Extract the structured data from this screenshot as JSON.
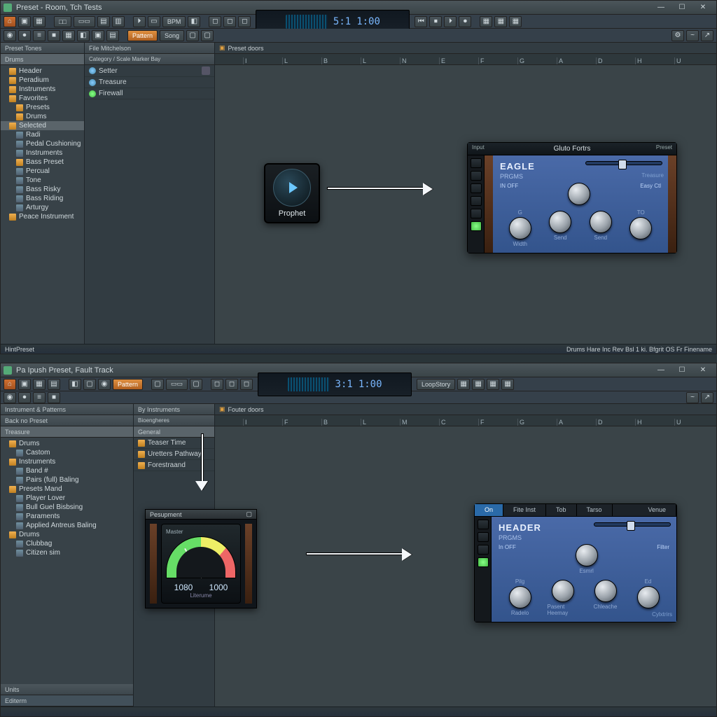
{
  "top": {
    "title": "Preset - Room, Tch Tests",
    "toolbar": {
      "row1_labels": [
        "⌂",
        "▣",
        "□",
        "▦",
        "≡",
        "▭",
        "✚"
      ],
      "row2_labels": [
        "◉",
        "⏺",
        "≡",
        "■",
        "▦",
        "◧",
        "▣",
        "▤"
      ],
      "pattern_btn": "Pattern",
      "song_btn": "Song",
      "bpm_btn": "BPM"
    },
    "transport": {
      "bar": "5:1",
      "time": "1:00"
    },
    "left_header": "Preset Tones",
    "left_tab": "Drums",
    "tree": [
      {
        "t": "Header",
        "lv": 1,
        "i": "folder"
      },
      {
        "t": "Peradium",
        "lv": 1,
        "i": "folder"
      },
      {
        "t": "Instruments",
        "lv": 1,
        "i": "folder"
      },
      {
        "t": "Favorites",
        "lv": 1,
        "i": "folder"
      },
      {
        "t": "Presets",
        "lv": 2,
        "i": "folder"
      },
      {
        "t": "Drums",
        "lv": 2,
        "i": "folder"
      },
      {
        "t": "Selected",
        "lv": 1,
        "i": "folder",
        "sel": true
      },
      {
        "t": "Radi",
        "lv": 2,
        "i": "file"
      },
      {
        "t": "Pedal Cushioning",
        "lv": 2,
        "i": "file"
      },
      {
        "t": "Instruments",
        "lv": 2,
        "i": "file"
      },
      {
        "t": "Bass Preset",
        "lv": 2,
        "i": "folder"
      },
      {
        "t": "Percual",
        "lv": 2,
        "i": "file"
      },
      {
        "t": "Tone",
        "lv": 2,
        "i": "file"
      },
      {
        "t": "Bass Risky",
        "lv": 2,
        "i": "file"
      },
      {
        "t": "Bass Riding",
        "lv": 2,
        "i": "file"
      },
      {
        "t": "Arturgy",
        "lv": 2,
        "i": "file"
      },
      {
        "t": "Peace Instrument",
        "lv": 1,
        "i": "folder"
      }
    ],
    "mid_header": "File Mitchelson",
    "mid_sub": "Category / Scale Marker Bay",
    "mid_items": [
      {
        "t": "Setter",
        "i": "blue",
        "badge": true
      },
      {
        "t": "Treasure",
        "i": "blue"
      },
      {
        "t": "Firewall",
        "i": "green"
      }
    ],
    "canvas_header": "Preset doors",
    "ruler": [
      "I",
      "L",
      "B",
      "L",
      "N",
      "E",
      "F",
      "G",
      "A",
      "D",
      "H",
      "U"
    ],
    "status_left": "HintPreset",
    "status": [
      "Drums",
      "Hare Inc",
      "Rev",
      "Bsl 1 ki.",
      "Bfgrit OS",
      "Fr",
      "Finename"
    ],
    "tile": {
      "label": "Prophet"
    },
    "instr_title": "Gluto Fortrs",
    "instr_left": "Input",
    "instr_right": "Preset",
    "instr_hdr": "EAGLE",
    "instr_sub": "PRGMS",
    "instr_row1_left": "IN OFF",
    "instr_row1_right": "Easy Ctl",
    "instr_knobs_top": [
      {
        "top": "",
        "bot": ""
      }
    ],
    "instr_knobs": [
      {
        "top": "G",
        "bot": "Width"
      },
      {
        "top": "",
        "bot": "Send"
      },
      {
        "top": "",
        "bot": "Send"
      },
      {
        "top": "TO",
        "bot": ""
      }
    ],
    "instr_corner": "Treasure"
  },
  "bottom": {
    "title": "Pa Ipush Preset, Fault Track",
    "toolbar": {
      "pattern_btn": "Pattern"
    },
    "transport": {
      "bar": "3:1",
      "time": "1:00"
    },
    "transport_label": "LoopStory",
    "left_header1": "Instrument & Patterns",
    "left_header2": "Back no Preset",
    "left_tab": "Treasure",
    "tree": [
      {
        "t": "Drums",
        "lv": 1,
        "i": "folder"
      },
      {
        "t": "Castom",
        "lv": 2,
        "i": "file"
      },
      {
        "t": "Instruments",
        "lv": 1,
        "i": "folder"
      },
      {
        "t": "Band #",
        "lv": 2,
        "i": "file"
      },
      {
        "t": "Pairs (full) Baling",
        "lv": 2,
        "i": "file"
      },
      {
        "t": "Presets Mand",
        "lv": 1,
        "i": "folder"
      },
      {
        "t": "Player Lover",
        "lv": 2,
        "i": "file"
      },
      {
        "t": "Bull Guel Bisbsing",
        "lv": 2,
        "i": "file"
      },
      {
        "t": "Paraments",
        "lv": 2,
        "i": "file"
      },
      {
        "t": "Applied Antreus Baling",
        "lv": 2,
        "i": "file"
      },
      {
        "t": "Drums",
        "lv": 1,
        "i": "folder"
      },
      {
        "t": "Clubbag",
        "lv": 2,
        "i": "file"
      },
      {
        "t": "Citizen sim",
        "lv": 2,
        "i": "file"
      }
    ],
    "tree_footer": [
      "Units",
      "Editerm"
    ],
    "mid_header": "By Instruments",
    "mid_sub": "Bioengheres",
    "mid_tab": "General",
    "mid_items": [
      {
        "t": "Teaser Time",
        "i": "folder"
      },
      {
        "t": "Uretters Pathway",
        "i": "folder"
      },
      {
        "t": "Forestraand",
        "i": "folder"
      }
    ],
    "canvas_header": "Fouter doors",
    "ruler": [
      "I",
      "F",
      "B",
      "L",
      "M",
      "C",
      "F",
      "G",
      "A",
      "D",
      "H",
      "U"
    ],
    "gauge": {
      "title": "Pesupment",
      "tl": "Master",
      "tr": "",
      "v1": "1080",
      "v2": "1000",
      "v2lab": "Literume"
    },
    "instr_tabs": [
      "On",
      "Fite Inst",
      "Tob",
      "Tarso"
    ],
    "instr_tabs_r": "Venue",
    "instr_hdr": "HEADER",
    "instr_sub": "PRGMS",
    "instr_row1_left": "In OFF",
    "instr_row1_right": "Filter",
    "instr_knobs_top": [
      {
        "top": "",
        "bot": "Esmrl"
      }
    ],
    "instr_knobs": [
      {
        "top": "Pilg",
        "bot": "Radelo"
      },
      {
        "top": "",
        "bot": "Pasent Heemay"
      },
      {
        "top": "",
        "bot": "Chleache"
      },
      {
        "top": "Ed",
        "bot": ""
      }
    ],
    "instr_corner": "Cylxtrirs"
  },
  "win_btns": {
    "min": "—",
    "max": "☐",
    "close": "✕"
  }
}
